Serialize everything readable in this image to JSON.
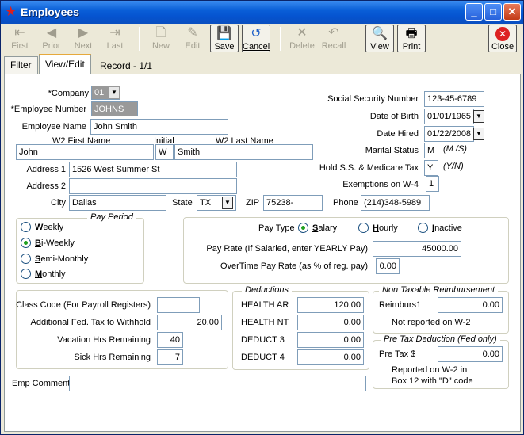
{
  "window": {
    "title": "Employees"
  },
  "toolbar": {
    "first": "First",
    "prior": "Prior",
    "next": "Next",
    "last": "Last",
    "new": "New",
    "edit": "Edit",
    "save": "Save",
    "cancel": "Cancel",
    "delete": "Delete",
    "recall": "Recall",
    "view": "View",
    "print": "Print",
    "close": "Close"
  },
  "tabs": {
    "filter": "Filter",
    "view_edit": "View/Edit"
  },
  "record_info": "Record - 1/1",
  "left": {
    "company_label": "*Company",
    "company_value": "01",
    "emp_number_label": "*Employee Number",
    "emp_number_value": "JOHNS",
    "emp_name_label": "Employee Name",
    "emp_name_value": "John Smith",
    "w2_first_label": "W2 First Name",
    "w2_first_value": "John",
    "initial_label": "Initial",
    "initial_value": "W",
    "w2_last_label": "W2 Last Name",
    "w2_last_value": "Smith",
    "address1_label": "Address 1",
    "address1_value": "1526 West Summer St",
    "address2_label": "Address 2",
    "address2_value": "",
    "city_label": "City",
    "city_value": "Dallas",
    "state_label": "State",
    "state_value": "TX",
    "zip_label": "ZIP",
    "zip_value": "75238-",
    "phone_label": "Phone",
    "phone_value": "(214)348-5989"
  },
  "right": {
    "ssn_label": "Social Security Number",
    "ssn_value": "123-45-6789",
    "dob_label": "Date of Birth",
    "dob_value": "01/01/1965",
    "hired_label": "Date Hired",
    "hired_value": "01/22/2008",
    "marital_label": "Marital Status",
    "marital_value": "M",
    "marital_hint": "(M /S)",
    "hold_label": "Hold S.S. & Medicare Tax",
    "hold_value": "Y",
    "hold_hint": "(Y/N)",
    "exemptions_label": "Exemptions on W-4",
    "exemptions_value": "1"
  },
  "pay_period": {
    "title": "Pay Period",
    "weekly_key": "W",
    "weekly_rest": "eekly",
    "biweekly_key": "B",
    "biweekly_rest": "i-Weekly",
    "semimonthly_key": "S",
    "semimonthly_rest": "emi-Monthly",
    "monthly_key": "M",
    "monthly_rest": "onthly",
    "selected": "Bi-Weekly"
  },
  "pay_type": {
    "label": "Pay Type",
    "salary_key": "S",
    "salary_rest": "alary",
    "hourly_key": "H",
    "hourly_rest": "ourly",
    "inactive_key": "I",
    "inactive_rest": "nactive",
    "selected": "Salary",
    "rate_label": "Pay Rate (If Salaried, enter YEARLY Pay)",
    "rate_value": "45000.00",
    "ot_label": "OverTime Pay Rate (as % of reg. pay)",
    "ot_value": "0.00"
  },
  "misc": {
    "class_code_label": "Class Code (For Payroll Registers)",
    "class_code_value": "",
    "add_fed_label": "Additional Fed. Tax to Withhold",
    "add_fed_value": "20.00",
    "vacation_label": "Vacation Hrs Remaining",
    "vacation_value": "40",
    "sick_label": "Sick Hrs Remaining",
    "sick_value": "7"
  },
  "deductions": {
    "title": "Deductions",
    "items": [
      {
        "label": "HEALTH AR",
        "value": "120.00"
      },
      {
        "label": "HEALTH NT",
        "value": "0.00"
      },
      {
        "label": "DEDUCT 3",
        "value": "0.00"
      },
      {
        "label": "DEDUCT 4",
        "value": "0.00"
      }
    ]
  },
  "non_taxable": {
    "title": "Non Taxable Reimbursement",
    "reimburs_label": "Reimburs1",
    "reimburs_value": "0.00",
    "note": "Not reported on W-2"
  },
  "pretax": {
    "title": "Pre Tax Deduction (Fed only)",
    "label": "Pre Tax $",
    "value": "0.00",
    "note_line1": "Reported on W-2 in",
    "note_line2": "Box 12 with \"D\" code"
  },
  "comment": {
    "label": "Emp Comment",
    "value": ""
  },
  "icons": {
    "first": "⇤",
    "prior": "◀",
    "next": "▶",
    "last": "⇥",
    "new": "🗋",
    "edit": "✎",
    "save": "💾",
    "cancel": "↺",
    "delete": "✕",
    "recall": "↶",
    "view": "🔍",
    "print": "🖶",
    "close": "✕"
  }
}
